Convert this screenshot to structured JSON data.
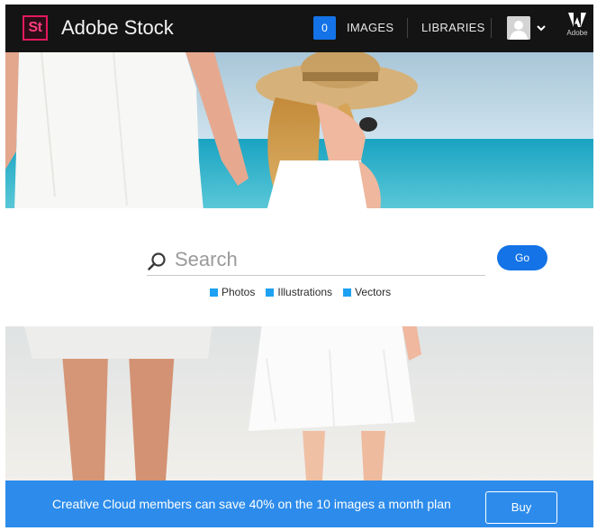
{
  "header": {
    "logo_text": "St",
    "brand_name": "Adobe Stock",
    "images_count": "0",
    "images_label": "IMAGES",
    "libraries_label": "LIBRARIES",
    "adobe_label": "Adobe"
  },
  "hero": {
    "image": "beach-mother-daughter-photo"
  },
  "search": {
    "placeholder": "Search",
    "icon": "search-icon",
    "go_label": "Go",
    "filters": [
      {
        "label": "Photos"
      },
      {
        "label": "Illustrations"
      },
      {
        "label": "Vectors"
      }
    ]
  },
  "promo": {
    "text": "Creative Cloud members can save 40% on the 10 images a month plan",
    "buy_label": "Buy"
  },
  "colors": {
    "header_bg": "#141414",
    "brand_pink": "#e3195d",
    "accent_blue": "#1473e6",
    "promo_blue": "#2d8ceb",
    "filter_blue": "#1da1f2"
  }
}
